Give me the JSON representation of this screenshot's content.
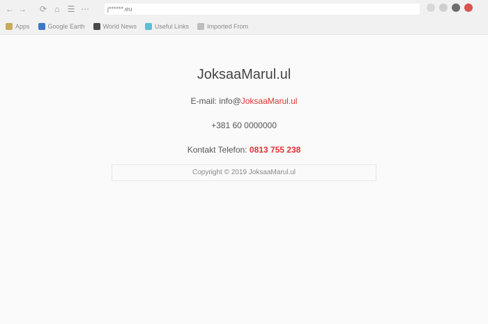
{
  "browser": {
    "url": "j******.eu",
    "bookmarks": [
      {
        "label": "Apps",
        "icon": "apps-icon"
      },
      {
        "label": "Google Earth",
        "icon": "bookmark-icon"
      },
      {
        "label": "World News",
        "icon": "bookmark-icon"
      },
      {
        "label": "Useful Links",
        "icon": "bookmark-icon"
      },
      {
        "label": "Imported From",
        "icon": "folder-icon"
      }
    ]
  },
  "content": {
    "title": "JoksaaMarul.ul",
    "email": {
      "label": "E-mail: ",
      "prefix": "info@",
      "value": "JoksaaMarul.ul"
    },
    "tel": "+381 60 0000000",
    "phone": {
      "label": "Kontakt Telefon: ",
      "value": "0813 755 238"
    },
    "box_text": "Copyright © 2019 JoksaaMarul.ul"
  }
}
